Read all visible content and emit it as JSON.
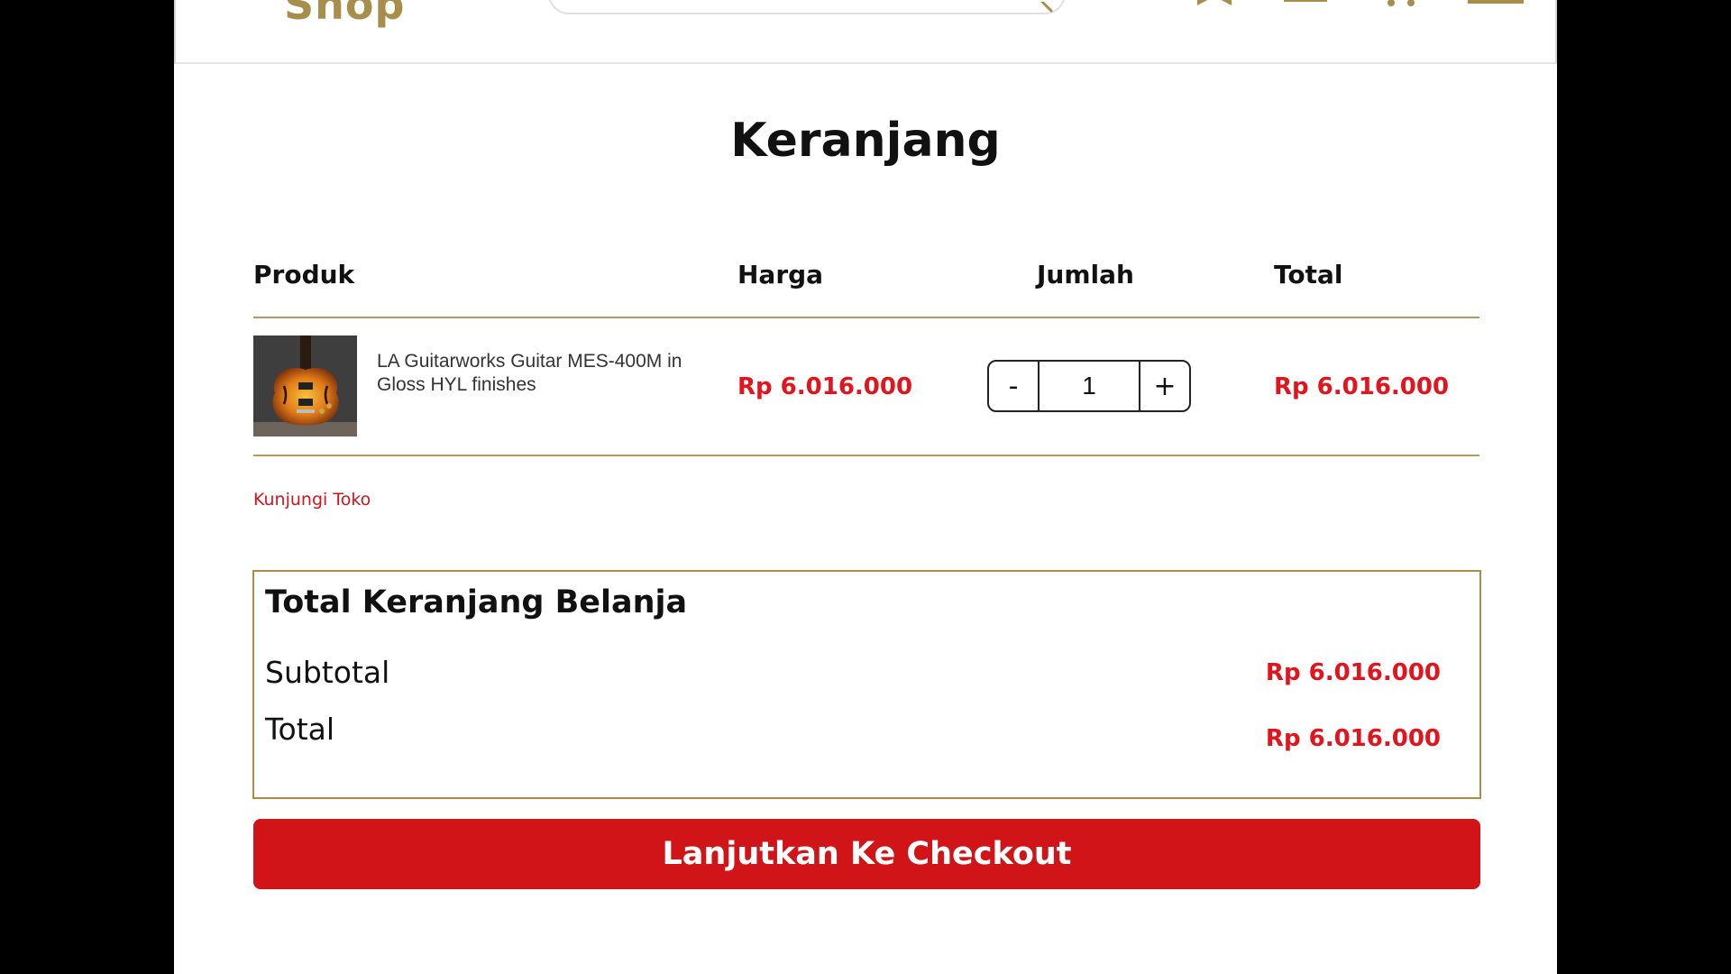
{
  "header": {
    "logo_text": "Shop",
    "icons": [
      "bookmark-icon",
      "menu-icon",
      "cart-icon",
      "mail-icon"
    ]
  },
  "cart": {
    "title": "Keranjang",
    "columns": {
      "product": "Produk",
      "price": "Harga",
      "quantity": "Jumlah",
      "total": "Total"
    },
    "items": [
      {
        "name": "LA Guitarworks Guitar MES-400M in Gloss HYL finishes",
        "price": "Rp 6.016.000",
        "quantity": "1",
        "total": "Rp 6.016.000"
      }
    ],
    "stepper": {
      "minus": "-",
      "plus": "+"
    },
    "visit_store": "Kunjungi Toko"
  },
  "summary": {
    "title": "Total Keranjang Belanja",
    "subtotal_label": "Subtotal",
    "subtotal_value": "Rp 6.016.000",
    "total_label": "Total",
    "total_value": "Rp 6.016.000"
  },
  "checkout_label": "Lanjutkan Ke Checkout",
  "colors": {
    "brand_gold": "#a88e4b",
    "price_red": "#e2141d",
    "button_red": "#d01417"
  }
}
